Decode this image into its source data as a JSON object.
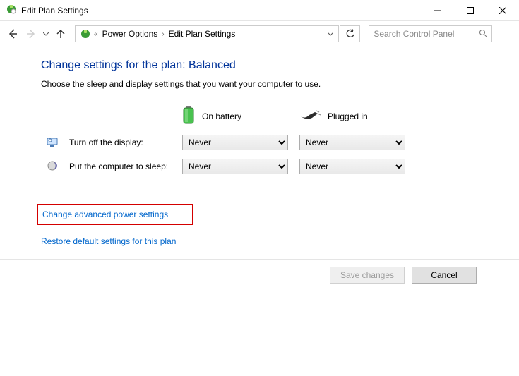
{
  "window": {
    "title": "Edit Plan Settings"
  },
  "breadcrumb": {
    "items": [
      "Power Options",
      "Edit Plan Settings"
    ]
  },
  "search": {
    "placeholder": "Search Control Panel"
  },
  "page": {
    "heading": "Change settings for the plan: Balanced",
    "desc": "Choose the sleep and display settings that you want your computer to use."
  },
  "columns": {
    "battery": "On battery",
    "plugged": "Plugged in"
  },
  "rows": {
    "display": {
      "label": "Turn off the display:",
      "battery_value": "Never",
      "plugged_value": "Never"
    },
    "sleep": {
      "label": "Put the computer to sleep:",
      "battery_value": "Never",
      "plugged_value": "Never"
    }
  },
  "links": {
    "advanced": "Change advanced power settings",
    "restore": "Restore default settings for this plan"
  },
  "buttons": {
    "save": "Save changes",
    "cancel": "Cancel"
  }
}
